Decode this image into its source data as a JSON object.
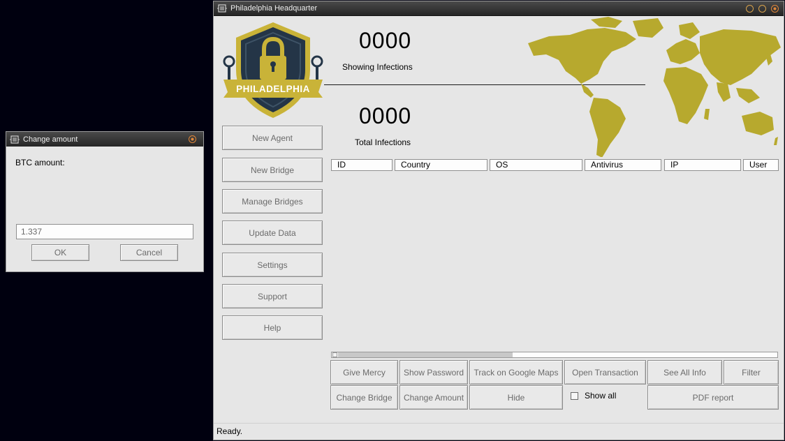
{
  "main_window": {
    "title": "Philadelphia Headquarter",
    "logo_text": "PHILADELPHIA",
    "showing_count": "0000",
    "showing_label": "Showing Infections",
    "total_count": "0000",
    "total_label": "Total Infections",
    "sidebar_buttons": [
      "New Agent",
      "New Bridge",
      "Manage Bridges",
      "Update Data",
      "Settings",
      "Support",
      "Help"
    ],
    "table_columns": [
      "ID",
      "Country",
      "OS",
      "Antivirus",
      "IP",
      "User"
    ],
    "action_row1": [
      "Give Mercy",
      "Show Password",
      "Track on Google Maps",
      "Open Transaction",
      "See All Info",
      "Filter"
    ],
    "action_row2": [
      "Change Bridge",
      "Change Amount",
      "Hide"
    ],
    "show_all_label": "Show all",
    "pdf_label": "PDF report",
    "status": "Ready."
  },
  "dialog": {
    "title": "Change amount",
    "label": "BTC amount:",
    "value": "1.337",
    "ok_label": "OK",
    "cancel_label": "Cancel"
  },
  "colors": {
    "map_fill": "#b7a92e",
    "shield_dark": "#243547",
    "shield_gold": "#c9b338",
    "titlebar": "#2e2e2e",
    "window_bg": "#e6e6e6"
  }
}
